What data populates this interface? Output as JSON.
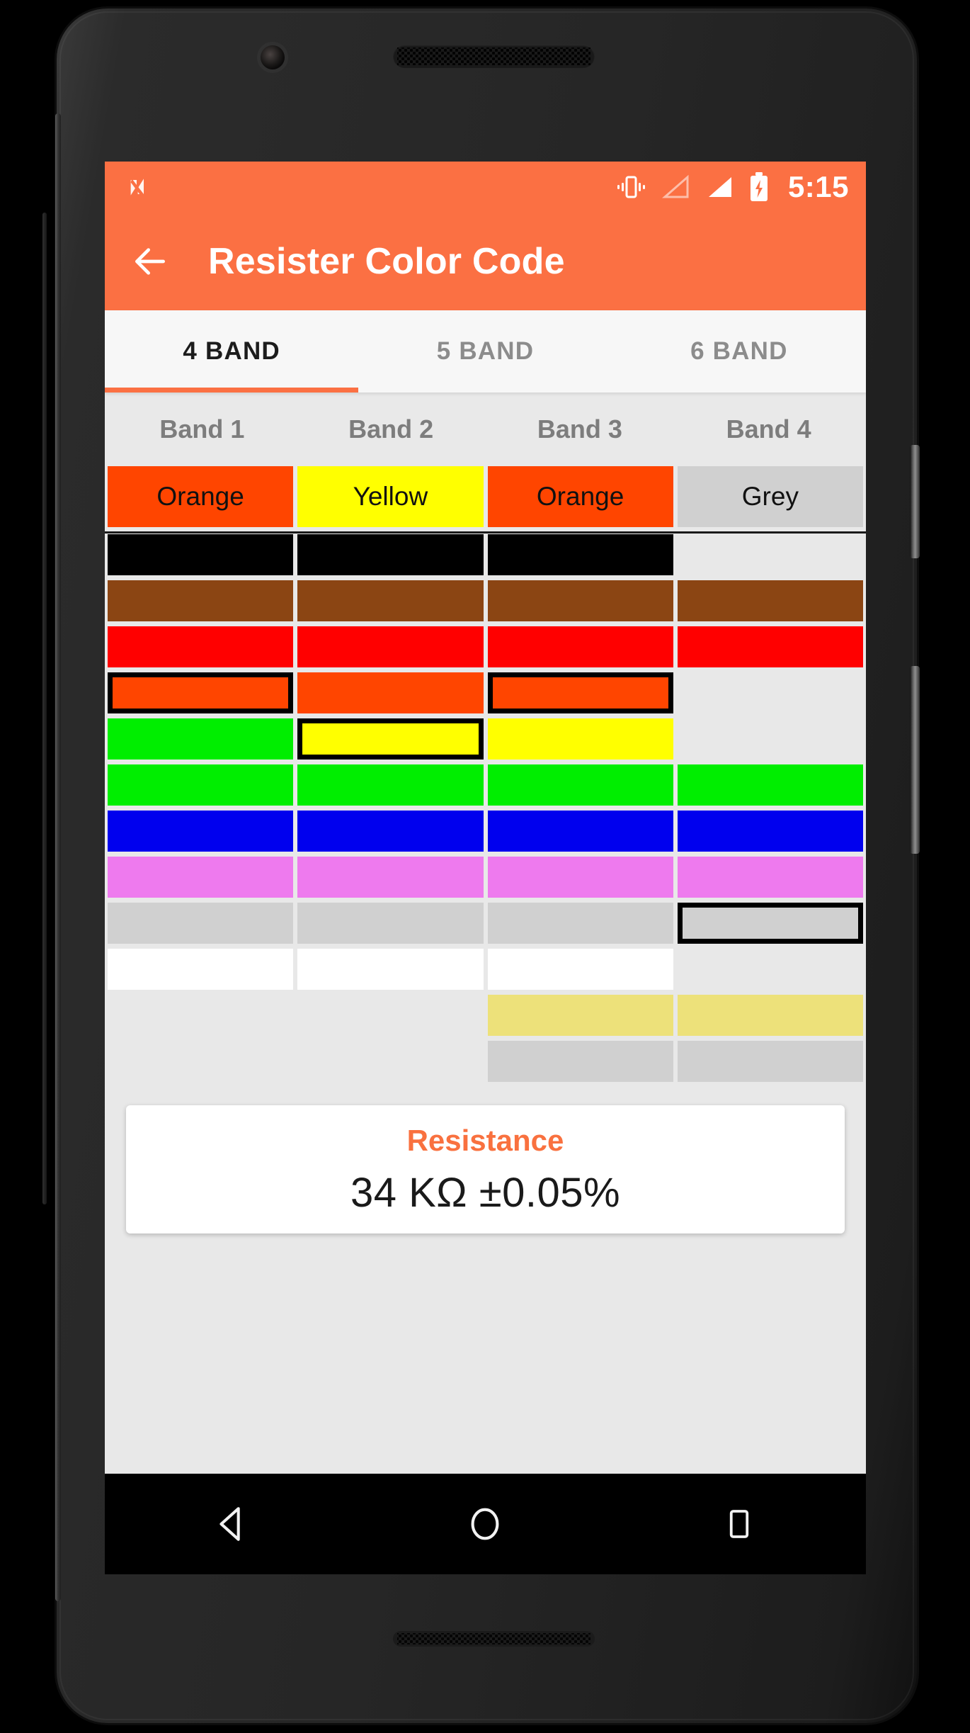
{
  "status_bar": {
    "time": "5:15",
    "icons": [
      "vibrate-icon",
      "signal-empty-icon",
      "signal-full-icon",
      "battery-charging-icon"
    ]
  },
  "app_bar": {
    "back_label": "back-arrow-icon",
    "title": "Resister Color Code"
  },
  "tabs": [
    {
      "label": "4 BAND",
      "active": true
    },
    {
      "label": "5 BAND",
      "active": false
    },
    {
      "label": "6 BAND",
      "active": false
    }
  ],
  "band_headers": [
    "Band 1",
    "Band 2",
    "Band 3",
    "Band 4"
  ],
  "selected_values": [
    {
      "label": "Orange",
      "color": "#FF4500"
    },
    {
      "label": "Yellow",
      "color": "#FFFF00"
    },
    {
      "label": "Orange",
      "color": "#FF4500"
    },
    {
      "label": "Grey",
      "color": "#D0D0D0"
    }
  ],
  "swatch_rows": [
    {
      "name": "black",
      "cells": [
        {
          "color": "#000000",
          "selected": false
        },
        {
          "color": "#000000",
          "selected": false
        },
        {
          "color": "#000000",
          "selected": false
        },
        {
          "color": null,
          "selected": false
        }
      ]
    },
    {
      "name": "brown",
      "cells": [
        {
          "color": "#8B4513",
          "selected": false
        },
        {
          "color": "#8B4513",
          "selected": false
        },
        {
          "color": "#8B4513",
          "selected": false
        },
        {
          "color": "#8B4513",
          "selected": false
        }
      ]
    },
    {
      "name": "red",
      "cells": [
        {
          "color": "#FF0000",
          "selected": false
        },
        {
          "color": "#FF0000",
          "selected": false
        },
        {
          "color": "#FF0000",
          "selected": false
        },
        {
          "color": "#FF0000",
          "selected": false
        }
      ]
    },
    {
      "name": "orange",
      "cells": [
        {
          "color": "#FF4500",
          "selected": true
        },
        {
          "color": "#FF4500",
          "selected": false
        },
        {
          "color": "#FF4500",
          "selected": true
        },
        {
          "color": null,
          "selected": false
        }
      ]
    },
    {
      "name": "yellow",
      "cells": [
        {
          "color": "#00EE00",
          "selected": false
        },
        {
          "color": "#FFFF00",
          "selected": true
        },
        {
          "color": "#FFFF00",
          "selected": false
        },
        {
          "color": null,
          "selected": false
        }
      ]
    },
    {
      "name": "green",
      "cells": [
        {
          "color": "#00EE00",
          "selected": false
        },
        {
          "color": "#00EE00",
          "selected": false
        },
        {
          "color": "#00EE00",
          "selected": false
        },
        {
          "color": "#00EE00",
          "selected": false
        }
      ]
    },
    {
      "name": "blue",
      "cells": [
        {
          "color": "#0000EE",
          "selected": false
        },
        {
          "color": "#0000EE",
          "selected": false
        },
        {
          "color": "#0000EE",
          "selected": false
        },
        {
          "color": "#0000EE",
          "selected": false
        }
      ]
    },
    {
      "name": "violet",
      "cells": [
        {
          "color": "#EE7AEE",
          "selected": false
        },
        {
          "color": "#EE7AEE",
          "selected": false
        },
        {
          "color": "#EE7AEE",
          "selected": false
        },
        {
          "color": "#EE7AEE",
          "selected": false
        }
      ]
    },
    {
      "name": "grey",
      "cells": [
        {
          "color": "#D0D0D0",
          "selected": false
        },
        {
          "color": "#D0D0D0",
          "selected": false
        },
        {
          "color": "#D0D0D0",
          "selected": false
        },
        {
          "color": "#D0D0D0",
          "selected": true
        }
      ]
    },
    {
      "name": "white",
      "cells": [
        {
          "color": "#FFFFFF",
          "selected": false
        },
        {
          "color": "#FFFFFF",
          "selected": false
        },
        {
          "color": "#FFFFFF",
          "selected": false
        },
        {
          "color": null,
          "selected": false
        }
      ]
    },
    {
      "name": "gold",
      "cells": [
        {
          "color": null,
          "selected": false
        },
        {
          "color": null,
          "selected": false
        },
        {
          "color": "#EDE17A",
          "selected": false
        },
        {
          "color": "#EDE17A",
          "selected": false
        }
      ]
    },
    {
      "name": "silver",
      "cells": [
        {
          "color": null,
          "selected": false
        },
        {
          "color": null,
          "selected": false
        },
        {
          "color": "#D0D0D0",
          "selected": false
        },
        {
          "color": "#D0D0D0",
          "selected": false
        }
      ]
    }
  ],
  "result": {
    "label": "Resistance",
    "value": "34 KΩ ±0.05%"
  },
  "nav_bar": {
    "back": "nav-back-icon",
    "home": "nav-home-icon",
    "recents": "nav-recents-icon"
  },
  "colors": {
    "accent": "#fb7043",
    "screen_bg": "#e8e8e8",
    "tab_bg": "#f7f7f7"
  }
}
